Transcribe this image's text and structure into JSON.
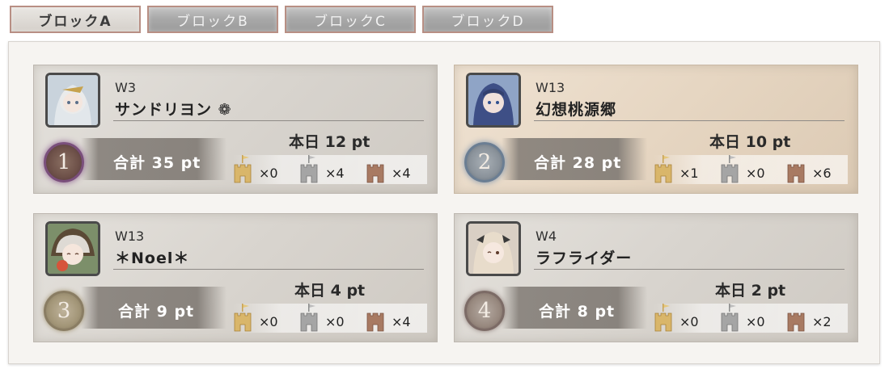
{
  "tabs": [
    {
      "label": "ブロックA",
      "active": true
    },
    {
      "label": "ブロックB",
      "active": false
    },
    {
      "label": "ブロックC",
      "active": false
    },
    {
      "label": "ブロックD",
      "active": false
    }
  ],
  "colors": {
    "castle_gold": "#d9b66a",
    "castle_silver": "#a5a5a5",
    "castle_bronze": "#a87a62",
    "highlight_card": "#e6d6c2"
  },
  "players": [
    {
      "rank": "1",
      "world": "W3",
      "name": "サンドリヨン ❁",
      "today": "本日 12 pt",
      "total": "合計 35 pt",
      "castles": [
        {
          "icon": "gold-castle-icon",
          "count": "×0"
        },
        {
          "icon": "silver-castle-icon",
          "count": "×4"
        },
        {
          "icon": "bronze-castle-icon",
          "count": "×4"
        }
      ],
      "highlight": false
    },
    {
      "rank": "2",
      "world": "W13",
      "name": "幻想桃源郷",
      "today": "本日 10 pt",
      "total": "合計 28 pt",
      "castles": [
        {
          "icon": "gold-castle-icon",
          "count": "×1"
        },
        {
          "icon": "silver-castle-icon",
          "count": "×0"
        },
        {
          "icon": "bronze-castle-icon",
          "count": "×6"
        }
      ],
      "highlight": true
    },
    {
      "rank": "3",
      "world": "W13",
      "name": "＊Noel＊",
      "today": "本日 4 pt",
      "total": "合計 9 pt",
      "castles": [
        {
          "icon": "gold-castle-icon",
          "count": "×0"
        },
        {
          "icon": "silver-castle-icon",
          "count": "×0"
        },
        {
          "icon": "bronze-castle-icon",
          "count": "×4"
        }
      ],
      "highlight": false
    },
    {
      "rank": "4",
      "world": "W4",
      "name": "ラフライダー",
      "today": "本日 2 pt",
      "total": "合計 8 pt",
      "castles": [
        {
          "icon": "gold-castle-icon",
          "count": "×0"
        },
        {
          "icon": "silver-castle-icon",
          "count": "×0"
        },
        {
          "icon": "bronze-castle-icon",
          "count": "×2"
        }
      ],
      "highlight": false
    }
  ]
}
